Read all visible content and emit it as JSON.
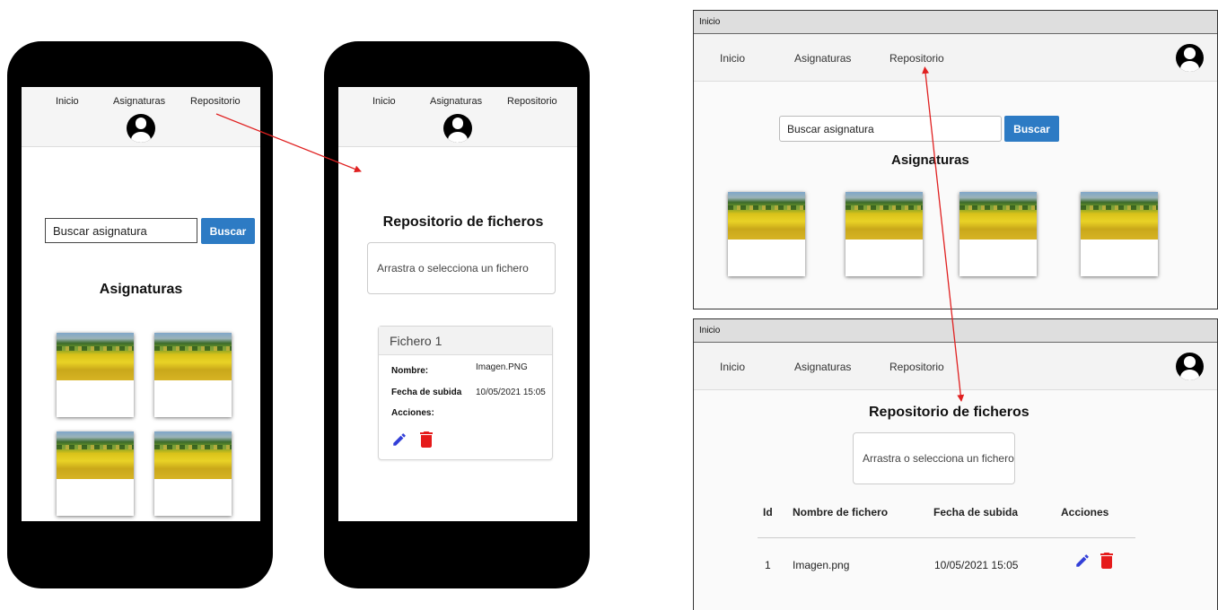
{
  "nav": {
    "inicio": "Inicio",
    "asignaturas": "Asignaturas",
    "repositorio": "Repositorio"
  },
  "window_title": "Inicio",
  "subjects_page": {
    "search_placeholder": "Buscar asignatura",
    "search_button": "Buscar",
    "heading": "Asignaturas",
    "mobile_card_count": 4,
    "desktop_card_count": 4
  },
  "repository_page": {
    "heading": "Repositorio de ficheros",
    "dropzone": "Arrastra o selecciona un fichero",
    "mobile_card": {
      "title": "Fichero 1",
      "nombre_label": "Nombre:",
      "nombre_value": "Imagen.PNG",
      "fecha_label": "Fecha de subida",
      "fecha_value": "10/05/2021 15:05",
      "acciones_label": "Acciones:"
    },
    "table": {
      "headers": [
        "Id",
        "Nombre de fichero",
        "Fecha de subida",
        "Acciones"
      ],
      "rows": [
        {
          "id": "1",
          "nombre": "Imagen.png",
          "fecha": "10/05/2021 15:05"
        }
      ]
    }
  },
  "colors": {
    "primary_button": "#2d7bc4",
    "edit_icon": "#3340d8",
    "delete_icon": "#e51b1b",
    "arrow": "#e02020"
  },
  "icons": [
    "user-avatar-icon",
    "pencil-icon",
    "trash-icon"
  ]
}
